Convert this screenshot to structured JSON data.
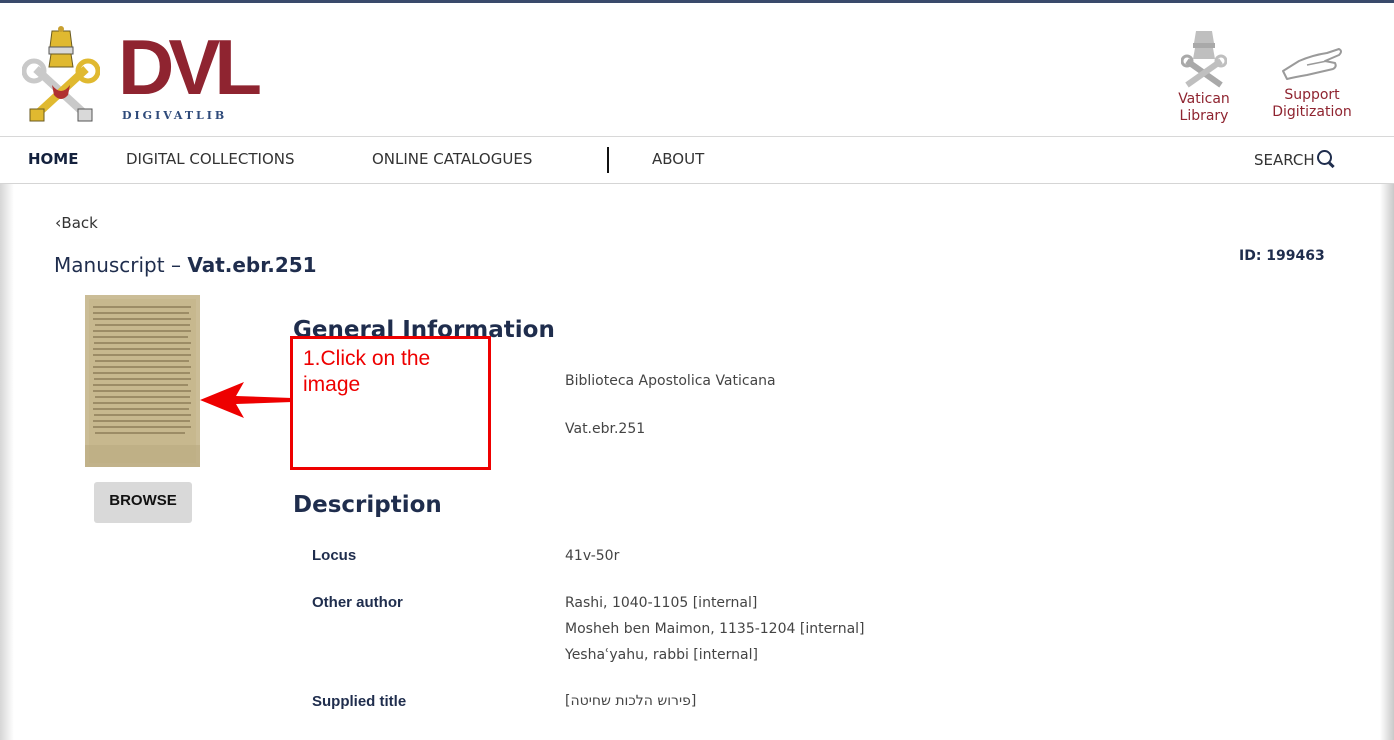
{
  "header": {
    "logo": {
      "text": "DVL",
      "subtitle": "DIGIVATLIB"
    },
    "vatican_link": {
      "line1": "Vatican",
      "line2": "Library",
      "icon": "vatican-crest-icon"
    },
    "support_link": {
      "line1": "Support",
      "line2": "Digitization",
      "icon": "hand-icon"
    }
  },
  "nav": {
    "items": [
      {
        "label": "HOME",
        "active": true
      },
      {
        "label": "DIGITAL COLLECTIONS",
        "active": false
      },
      {
        "label": "ONLINE CATALOGUES",
        "active": false
      },
      {
        "label": "ABOUT",
        "active": false
      }
    ],
    "search_label": "SEARCH"
  },
  "page": {
    "back_label": "Back",
    "title_prefix": "Manuscript – ",
    "title_shelfmark": "Vat.ebr.251",
    "id_label": "ID: 199463"
  },
  "browse_label": "BROWSE",
  "general": {
    "heading": "General Information",
    "values": [
      "Biblioteca Apostolica Vaticana",
      "Vat.ebr.251"
    ]
  },
  "description": {
    "heading": "Description",
    "fields": [
      {
        "label": "Locus",
        "values": [
          "41v-50r"
        ]
      },
      {
        "label": "Other author",
        "values": [
          "Rashi, 1040-1105 [internal]",
          "Mosheh ben Maimon, 1135-1204 [internal]",
          "Yeshaʿyahu, rabbi [internal]"
        ]
      },
      {
        "label": "Supplied title",
        "values": [
          "[פירוש הלכות שחיטה]"
        ]
      }
    ]
  },
  "annotation": {
    "text_line1": "1.Click on the",
    "text_line2": "image",
    "color": "#ee0000"
  },
  "colors": {
    "brand_red": "#8f2430",
    "navy": "#1f2d4d",
    "annotation": "#ee0000"
  }
}
